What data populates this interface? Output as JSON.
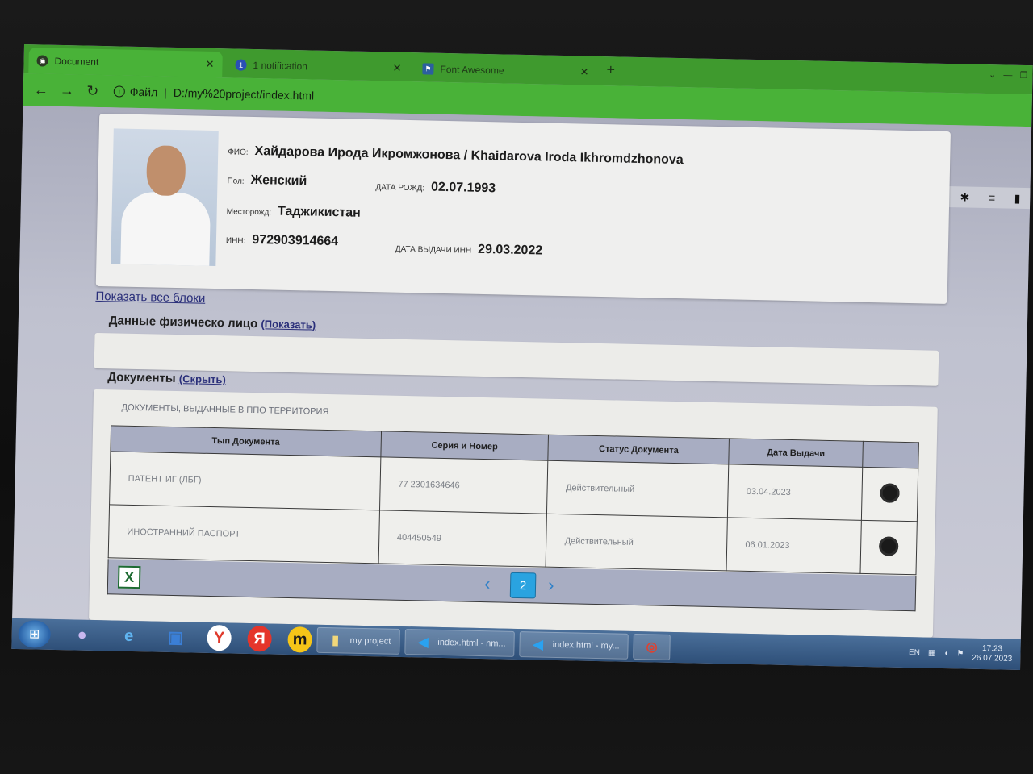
{
  "browser": {
    "tabs": [
      {
        "label": "Document",
        "icon": "globe-icon"
      },
      {
        "label": "1 notification",
        "icon": "notification-icon",
        "badge": "1"
      },
      {
        "label": "Font Awesome",
        "icon": "font-awesome-icon"
      }
    ],
    "address": {
      "scheme_label": "Файл",
      "url": "D:/my%20project/index.html"
    }
  },
  "profile": {
    "fio_label": "ФИО:",
    "fio_value": "Хайдарова Ирода Икромжонова / Khaidarova Iroda Ikhromdzhonova",
    "sex_label": "Пол:",
    "sex_value": "Женский",
    "birthdate_label": "ДАТА РОЖД:",
    "birthdate_value": "02.07.1993",
    "birthplace_label": "Месторожд:",
    "birthplace_value": "Таджикистан",
    "inn_label": "ИНН:",
    "inn_value": "972903914664",
    "inn_issue_label": "ДАТА ВЫДАЧИ ИНН",
    "inn_issue_value": "29.03.2022"
  },
  "links": {
    "show_all": "Показать все блоки"
  },
  "section_person": {
    "title": "Данные физическо лицо",
    "toggle": "(Показать)"
  },
  "section_docs": {
    "title": "Документы",
    "toggle": "(Скрыть)",
    "subtitle": "ДОКУМЕНТЫ, ВЫДАННЫЕ В ППО ТЕРРИТОРИЯ",
    "columns": [
      "Тып Документа",
      "Серия и Номер",
      "Статус Документа",
      "Дата Выдачи",
      ""
    ],
    "rows": [
      {
        "type": "ПАТЕНТ ИГ (ЛБГ)",
        "number": "77 2301634646",
        "status": "Действительный",
        "date": "03.04.2023"
      },
      {
        "type": "ИНОСТРАННИЙ ПАСПОРТ",
        "number": "404450549",
        "status": "Действительный",
        "date": "06.01.2023"
      }
    ],
    "pager": {
      "current_page": "2"
    }
  },
  "taskbar": {
    "windows": [
      {
        "label": "my project"
      },
      {
        "label": "index.html - hm..."
      },
      {
        "label": "index.html - my..."
      }
    ],
    "lang": "EN",
    "time": "17:23",
    "date": "26.07.2023"
  }
}
